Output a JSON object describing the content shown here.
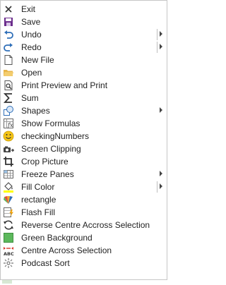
{
  "menu": {
    "items": [
      {
        "label": "Exit",
        "icon": "close-icon"
      },
      {
        "label": "Save",
        "icon": "save-icon"
      },
      {
        "label": "Undo",
        "icon": "undo-icon"
      },
      {
        "label": "Redo",
        "icon": "redo-icon"
      },
      {
        "label": "New File",
        "icon": "new-file-icon"
      },
      {
        "label": "Open",
        "icon": "open-folder-icon"
      },
      {
        "label": "Print Preview and Print",
        "icon": "print-preview-icon"
      },
      {
        "label": "Sum",
        "icon": "sigma-icon"
      },
      {
        "label": "Shapes",
        "icon": "shapes-icon"
      },
      {
        "label": "Show Formulas",
        "icon": "formulas-icon"
      },
      {
        "label": "checkingNumbers",
        "icon": "smiley-icon"
      },
      {
        "label": "Screen Clipping",
        "icon": "camera-icon"
      },
      {
        "label": "Crop Picture",
        "icon": "crop-icon"
      },
      {
        "label": "Freeze Panes",
        "icon": "freeze-panes-icon"
      },
      {
        "label": "Fill Color",
        "icon": "fill-bucket-icon"
      },
      {
        "label": "rectangle",
        "icon": "rectangle-logo-icon"
      },
      {
        "label": "Flash Fill",
        "icon": "flash-fill-icon"
      },
      {
        "label": "Reverse Centre Accross Selection",
        "icon": "reverse-icon"
      },
      {
        "label": "Green Background",
        "icon": "green-square-icon"
      },
      {
        "label": "Centre Across Selection",
        "icon": "center-across-icon"
      },
      {
        "label": "Podcast Sort",
        "icon": "sort-icon"
      }
    ]
  },
  "colors": {
    "green": "#5cb85c",
    "purple": "#6b2d8c",
    "blue": "#2f6fb8"
  }
}
